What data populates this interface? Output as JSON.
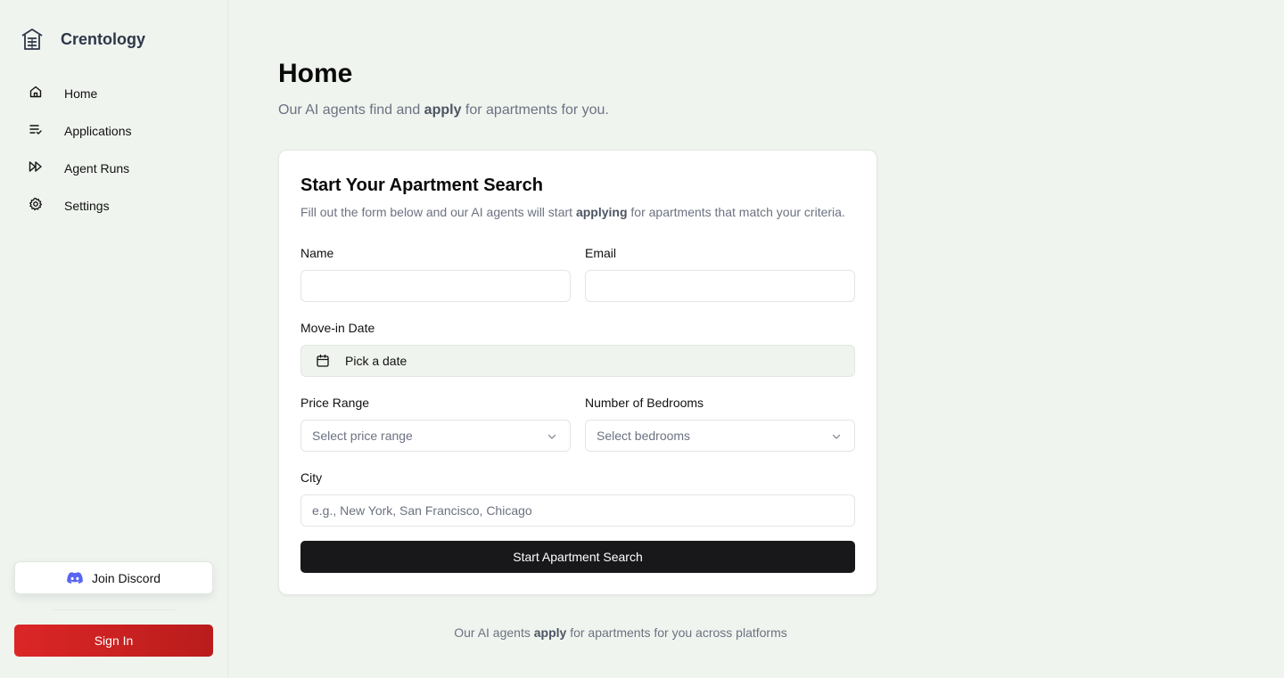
{
  "brand": {
    "name": "Crentology",
    "icon": "building-icon"
  },
  "nav": {
    "items": [
      {
        "label": "Home",
        "icon": "home-icon"
      },
      {
        "label": "Applications",
        "icon": "list-check-icon"
      },
      {
        "label": "Agent Runs",
        "icon": "fast-forward-icon"
      },
      {
        "label": "Settings",
        "icon": "gear-icon"
      }
    ]
  },
  "sidebar_footer": {
    "discord_label": "Join Discord",
    "signin_label": "Sign In"
  },
  "header": {
    "title": "Home",
    "subtitle_pre": "Our AI agents find and ",
    "subtitle_bold": "apply",
    "subtitle_post": " for apartments for you."
  },
  "form": {
    "title": "Start Your Apartment Search",
    "subtitle_pre": "Fill out the form below and our AI agents will start ",
    "subtitle_bold": "applying",
    "subtitle_post": " for apartments that match your criteria.",
    "name_label": "Name",
    "name_value": "",
    "email_label": "Email",
    "email_value": "",
    "movein_label": "Move-in Date",
    "movein_placeholder": "Pick a date",
    "price_label": "Price Range",
    "price_placeholder": "Select price range",
    "bedrooms_label": "Number of Bedrooms",
    "bedrooms_placeholder": "Select bedrooms",
    "city_label": "City",
    "city_placeholder": "e.g., New York, San Francisco, Chicago",
    "city_value": "",
    "submit_label": "Start Apartment Search"
  },
  "footer_note": {
    "pre": "Our AI agents ",
    "bold": "apply",
    "post": " for apartments for you across platforms"
  },
  "colors": {
    "background": "#f0f4ef",
    "signin_red": "#dc2626",
    "submit_dark": "#18181b",
    "discord_blurple": "#5865f2"
  }
}
